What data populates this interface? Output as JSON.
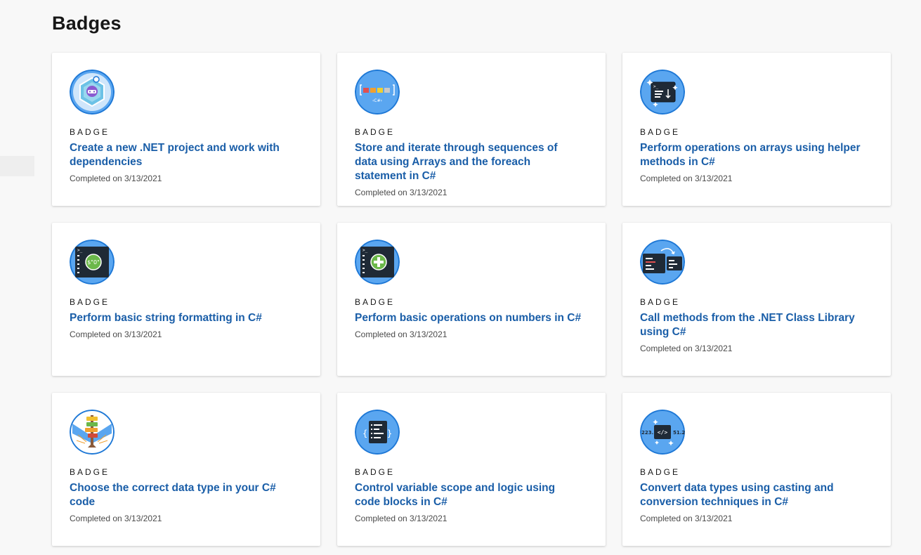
{
  "page": {
    "title": "Badges"
  },
  "labels": {
    "badge_type": "BADGE"
  },
  "colors": {
    "link": "#1a5ea8",
    "badge_ring": "#1e78d6",
    "badge_fill": "#5aa6f0",
    "card_bg": "#ffffff",
    "page_bg": "#f8f8f8"
  },
  "badges": [
    {
      "icon": "dotnet-bot-hexagon-icon",
      "title": "Create a new .NET project and work with dependencies",
      "completed": "Completed on 3/13/2021"
    },
    {
      "icon": "csharp-array-icon",
      "title": "Store and iterate through sequences of data using Arrays and the foreach statement in C#",
      "completed": "Completed on 3/13/2021"
    },
    {
      "icon": "terminal-sort-icon",
      "title": "Perform operations on arrays using helper methods in C#",
      "completed": "Completed on 3/13/2021"
    },
    {
      "icon": "terminal-string-format-icon",
      "title": "Perform basic string formatting in C#",
      "completed": "Completed on 3/13/2021"
    },
    {
      "icon": "terminal-plus-icon",
      "title": "Perform basic operations on numbers in C#",
      "completed": "Completed on 3/13/2021"
    },
    {
      "icon": "terminal-methods-icon",
      "title": "Call methods from the .NET Class Library using C#",
      "completed": "Completed on 3/13/2021"
    },
    {
      "icon": "signpost-icon",
      "title": "Choose the correct data type in your C# code",
      "completed": "Completed on 3/13/2021"
    },
    {
      "icon": "code-block-icon",
      "title": "Control variable scope and logic using code blocks in C#",
      "completed": "Completed on 3/13/2021"
    },
    {
      "icon": "code-conversion-icon",
      "title": "Convert data types using casting and conversion techniques in C#",
      "completed": "Completed on 3/13/2021"
    }
  ]
}
